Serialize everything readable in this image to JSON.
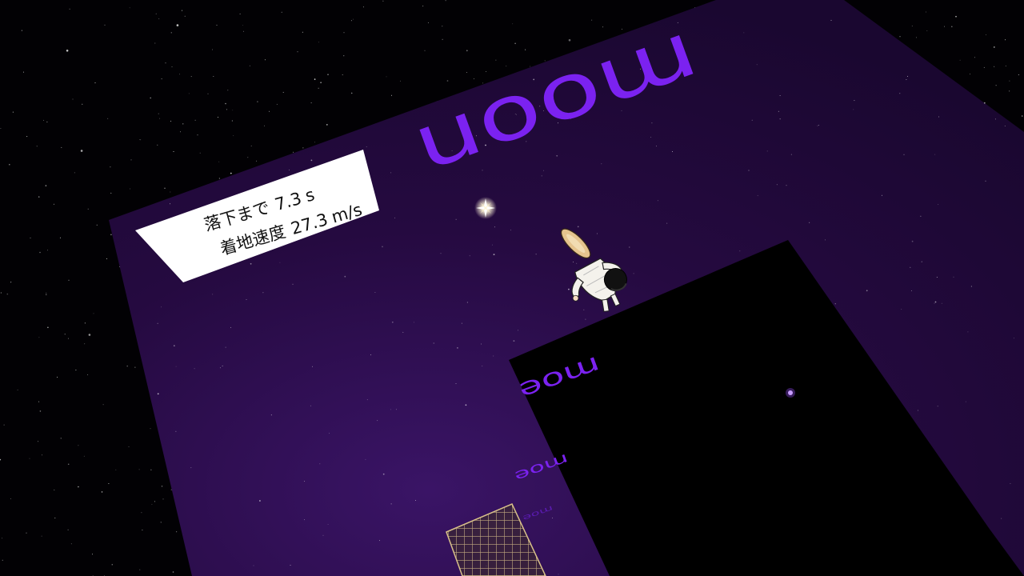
{
  "hud": {
    "fall_time_label": "落下まで",
    "fall_time_value": "7.3",
    "fall_time_unit": "s",
    "landing_speed_label": "着地速度",
    "landing_speed_value": "27.3",
    "landing_speed_unit": "m/s"
  },
  "floor_text": {
    "main": "moon",
    "echo_1": "moe",
    "echo_2": "moe",
    "echo_3": "moe"
  },
  "colors": {
    "space": "#020104",
    "floor_purple": "#2a0b45",
    "floor_text": "#7b22f0",
    "hud_bg": "#ffffff",
    "hud_text": "#111111",
    "grid_tile": "#d8c08a",
    "star_glow": "#fff6d8",
    "marker_purple": "#9b4dff"
  },
  "icons": {
    "player": "falling-character-icon",
    "star": "sparkle-star-icon",
    "marker": "purple-orb-icon",
    "grid": "grid-tile-icon"
  }
}
